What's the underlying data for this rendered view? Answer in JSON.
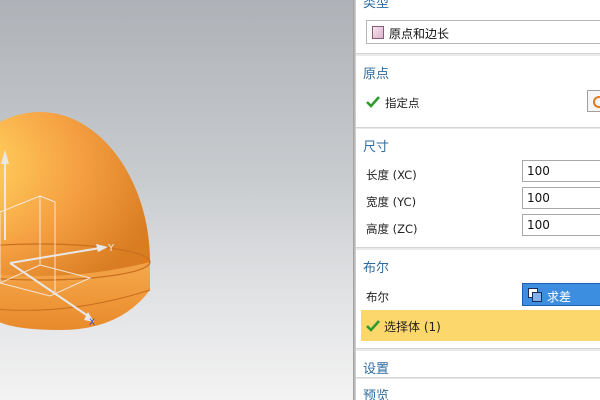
{
  "type_section": {
    "title": "类型",
    "dropdown_value": "原点和边长"
  },
  "origin_section": {
    "title": "原点",
    "specify_point_label": "指定点"
  },
  "dimensions_section": {
    "title": "尺寸",
    "rows": [
      {
        "label": "长度 (XC)",
        "value": "100"
      },
      {
        "label": "宽度 (YC)",
        "value": "100"
      },
      {
        "label": "高度 (ZC)",
        "value": "100"
      }
    ]
  },
  "boolean_section": {
    "title": "布尔",
    "boolean_label": "布尔",
    "boolean_value": "求差",
    "select_body_label": "选择体 (1)"
  },
  "settings_section": {
    "title": "设置"
  },
  "preview_section": {
    "title": "预览"
  },
  "viewport": {
    "axis_y": "Y",
    "axis_x": "X"
  },
  "colors": {
    "accent": "#2e6b9e",
    "highlight": "#fcd76c",
    "selected": "#3c8ee0",
    "check": "#2f9a2f",
    "dome": "#f5a042"
  }
}
